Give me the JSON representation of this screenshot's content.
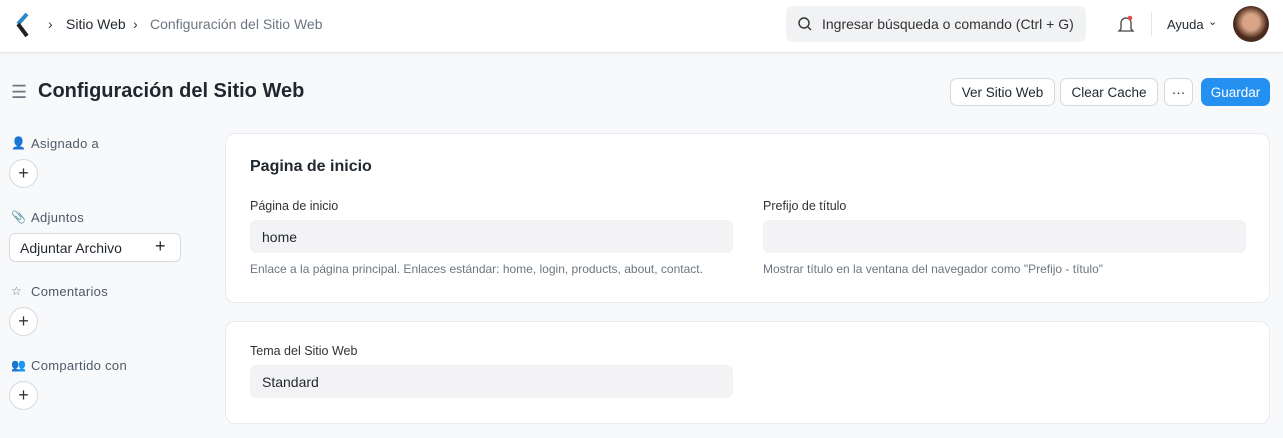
{
  "navbar": {
    "breadcrumbs": [
      "Sitio Web",
      "Configuración del Sitio Web"
    ],
    "search_placeholder": "Ingresar búsqueda o comando (Ctrl + G)",
    "help": "Ayuda"
  },
  "page": {
    "title": "Configuración del Sitio Web",
    "buttons": {
      "view": "Ver Sitio Web",
      "clear": "Clear Cache",
      "more": "···",
      "save": "Guardar"
    }
  },
  "sidebar": {
    "assigned": "Asignado a",
    "attachments": "Adjuntos",
    "attach_file": "Adjuntar Archivo",
    "comments": "Comentarios",
    "shared": "Compartido con"
  },
  "section1": {
    "title": "Pagina de inicio",
    "home_label": "Página de inicio",
    "home_value": "home",
    "home_desc": "Enlace a la página principal. Enlaces estándar: home, login, products, about, contact.",
    "prefix_label": "Prefijo de título",
    "prefix_value": "",
    "prefix_desc": "Mostrar título en la ventana del navegador como \"Prefijo - título\""
  },
  "section2": {
    "theme_label": "Tema del Sitio Web",
    "theme_value": "Standard"
  },
  "colors": {
    "primary": "#2490ef"
  }
}
